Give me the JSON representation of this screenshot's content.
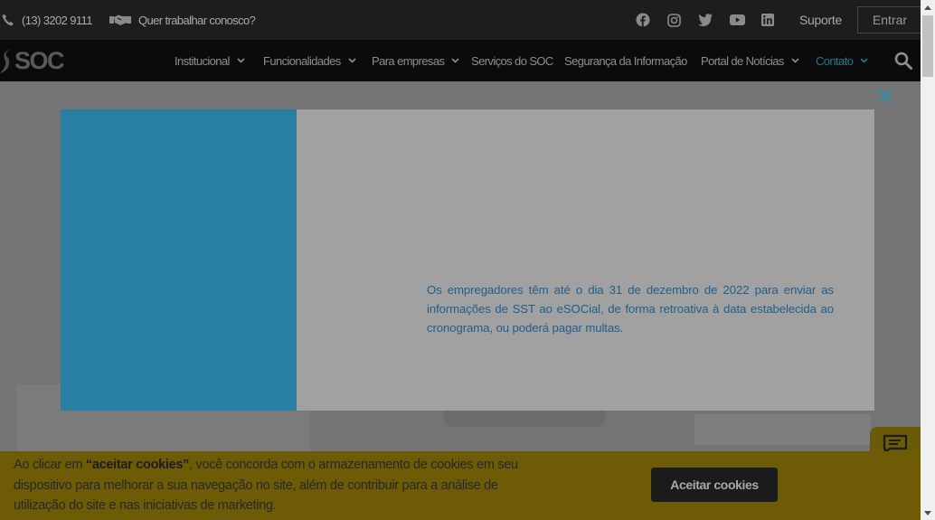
{
  "topbar": {
    "phone": "(13) 3202 9111",
    "careers": "Quer trabalhar conosco?",
    "social_icons": [
      "facebook-icon",
      "instagram-icon",
      "twitter-icon",
      "youtube-icon",
      "linkedin-icon"
    ],
    "support": "Suporte",
    "login": "Entrar"
  },
  "navbar": {
    "logo": "SOC",
    "items": [
      {
        "label": "Institucional",
        "dropdown": true
      },
      {
        "label": "Funcionalidades",
        "dropdown": true
      },
      {
        "label": "Para empresas",
        "dropdown": true
      },
      {
        "label": "Serviços do SOC",
        "dropdown": false
      },
      {
        "label": "Segurança da Informação",
        "dropdown": false
      },
      {
        "label": "Portal de Notícias",
        "dropdown": true
      },
      {
        "label": "Contato",
        "dropdown": true
      }
    ]
  },
  "modal": {
    "text": "Os empregadores têm até o dia 31 de dezembro de 2022 para enviar as informações de SST ao eSOCial, de forma retroativa à data estabelecida ao cronograma, ou poderá pagar multas."
  },
  "cookie": {
    "text_before": "Ao clicar em ",
    "text_bold": "“aceitar cookies”",
    "text_after": ", você concorda com o armazenamento de cookies em seu dispositivo para melhorar a sua navegação no site, além de contribuir para a análise de utilização do site e nas iniciativas de marketing.",
    "accept": "Aceitar cookies"
  },
  "colors": {
    "accent": "#1e7a8a",
    "modal_blue": "#277fa4",
    "cookie_bar": "#6e5b06"
  }
}
